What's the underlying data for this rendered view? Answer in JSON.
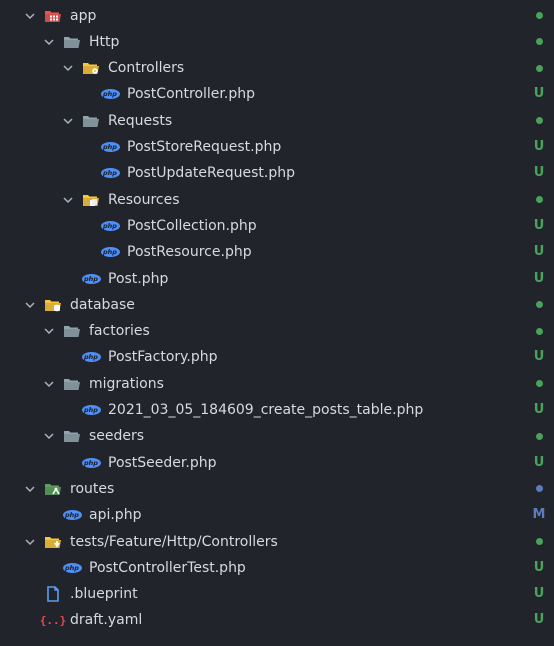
{
  "colors": {
    "background": "#21252b",
    "text": "#d7dae0",
    "chevron": "#abb2bf",
    "status_green": "#49a25a",
    "status_blue": "#5b7bbd",
    "folder_gray": "#90a4ae",
    "folder_yellow": "#f9c53b",
    "folder_red": "#ef5350",
    "folder_green": "#5da05e",
    "php_blue": "#4f8ff7",
    "file_blue": "#5c9ded",
    "yaml_red": "#e54b4b"
  },
  "items": [
    {
      "label": "app",
      "depth": 0,
      "chevron": true,
      "icon": "folder-app-icon",
      "status": "dot-green"
    },
    {
      "label": "Http",
      "depth": 1,
      "chevron": true,
      "icon": "folder-icon",
      "status": "dot-green"
    },
    {
      "label": "Controllers",
      "depth": 2,
      "chevron": true,
      "icon": "folder-controller-icon",
      "status": "dot-green"
    },
    {
      "label": "PostController.php",
      "depth": 3,
      "chevron": false,
      "icon": "php-icon",
      "status": "U"
    },
    {
      "label": "Requests",
      "depth": 2,
      "chevron": true,
      "icon": "folder-icon",
      "status": "dot-green"
    },
    {
      "label": "PostStoreRequest.php",
      "depth": 3,
      "chevron": false,
      "icon": "php-icon",
      "status": "U"
    },
    {
      "label": "PostUpdateRequest.php",
      "depth": 3,
      "chevron": false,
      "icon": "php-icon",
      "status": "U"
    },
    {
      "label": "Resources",
      "depth": 2,
      "chevron": true,
      "icon": "folder-resource-icon",
      "status": "dot-green"
    },
    {
      "label": "PostCollection.php",
      "depth": 3,
      "chevron": false,
      "icon": "php-icon",
      "status": "U"
    },
    {
      "label": "PostResource.php",
      "depth": 3,
      "chevron": false,
      "icon": "php-icon",
      "status": "U"
    },
    {
      "label": "Post.php",
      "depth": 2,
      "chevron": false,
      "icon": "php-icon",
      "status": "U"
    },
    {
      "label": "database",
      "depth": 0,
      "chevron": true,
      "icon": "folder-database-icon",
      "status": "dot-green"
    },
    {
      "label": "factories",
      "depth": 1,
      "chevron": true,
      "icon": "folder-icon",
      "status": "dot-green"
    },
    {
      "label": "PostFactory.php",
      "depth": 2,
      "chevron": false,
      "icon": "php-icon",
      "status": "U"
    },
    {
      "label": "migrations",
      "depth": 1,
      "chevron": true,
      "icon": "folder-icon",
      "status": "dot-green"
    },
    {
      "label": "2021_03_05_184609_create_posts_table.php",
      "depth": 2,
      "chevron": false,
      "icon": "php-icon",
      "status": "U"
    },
    {
      "label": "seeders",
      "depth": 1,
      "chevron": true,
      "icon": "folder-icon",
      "status": "dot-green"
    },
    {
      "label": "PostSeeder.php",
      "depth": 2,
      "chevron": false,
      "icon": "php-icon",
      "status": "U"
    },
    {
      "label": "routes",
      "depth": 0,
      "chevron": true,
      "icon": "folder-routes-icon",
      "status": "dot-blue"
    },
    {
      "label": "api.php",
      "depth": 1,
      "chevron": false,
      "icon": "php-icon",
      "status": "M"
    },
    {
      "label": "tests/Feature/Http/Controllers",
      "depth": 0,
      "chevron": true,
      "icon": "folder-test-icon",
      "status": "dot-green"
    },
    {
      "label": "PostControllerTest.php",
      "depth": 1,
      "chevron": false,
      "icon": "php-icon",
      "status": "U"
    },
    {
      "label": ".blueprint",
      "depth": 0,
      "chevron": false,
      "icon": "file-icon",
      "status": "U"
    },
    {
      "label": "draft.yaml",
      "depth": 0,
      "chevron": false,
      "icon": "yaml-icon",
      "status": "U"
    }
  ]
}
